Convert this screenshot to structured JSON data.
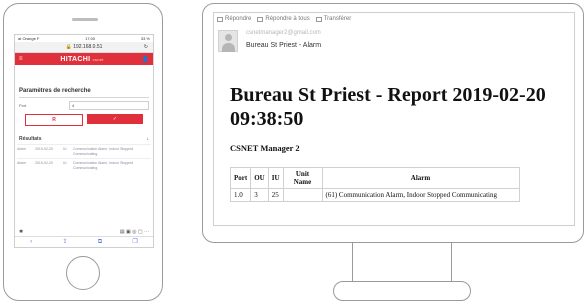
{
  "phone": {
    "statusbar": {
      "carrier": "at Orange F",
      "time": "17:00",
      "battery": "33 %"
    },
    "url": "192.168.0.51",
    "reload_icon": "reload-icon",
    "header": {
      "brand": "HITACHI",
      "brand_suffix": "csnet",
      "colors": {
        "accent": "#e0303b"
      }
    },
    "subline": "",
    "params_title": "Paramètres de recherche",
    "fields": [
      {
        "label": "Port",
        "value": "4"
      }
    ],
    "buttons": {
      "left": "R",
      "right": "✓"
    },
    "results_title": "Résultats",
    "results_icon": "↓",
    "rows": [
      {
        "c1": "Alarm",
        "c2": "2019-02-20",
        "c3": "IU",
        "c4": "Communication Alarm, Indoor Stopped Communicating"
      },
      {
        "c1": "Alarm",
        "c2": "2019-02-20",
        "c3": "IU",
        "c4": "Communication Alarm, Indoor Stopped Communicating"
      }
    ]
  },
  "email": {
    "toolbar": {
      "reply": "Répondre",
      "reply_all": "Répondre à tous",
      "forward": "Transférer"
    },
    "from": "csnetmanager2@gmail.com",
    "from_extra": "",
    "date": "",
    "subject": "Bureau St Priest - Alarm",
    "title": "Bureau St Priest - Report 2019-02-20 09:38:50",
    "manager": "CSNET Manager 2",
    "table": {
      "headers": [
        "Port",
        "OU",
        "IU",
        "Unit Name",
        "Alarm"
      ],
      "rows": [
        {
          "port": "1.0",
          "ou": "3",
          "iu": "25",
          "unit_name": "",
          "alarm": "(61) Communication Alarm, Indoor Stopped Communicating"
        }
      ]
    }
  }
}
